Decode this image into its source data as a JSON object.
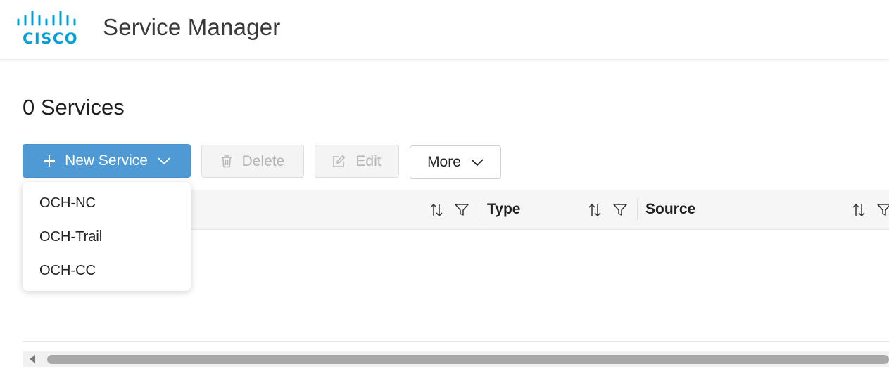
{
  "header": {
    "logo_text": "CISCO",
    "app_title": "Service Manager"
  },
  "page": {
    "count": "0",
    "title_word": "Services"
  },
  "toolbar": {
    "new_service_label": "New Service",
    "delete_label": "Delete",
    "edit_label": "Edit",
    "more_label": "More"
  },
  "dropdown": {
    "items": [
      "OCH-NC",
      "OCH-Trail",
      "OCH-CC"
    ]
  },
  "table": {
    "columns": [
      {
        "label": ""
      },
      {
        "label": "Type"
      },
      {
        "label": "Source"
      }
    ]
  },
  "colors": {
    "primary_button": "#4f9ad5",
    "cisco_blue": "#049fd9",
    "disabled_text": "#b5b5b5"
  },
  "icons": {
    "logo": "cisco-bars",
    "new_service": "plus-icon",
    "new_service_caret": "chevron-down-icon",
    "delete": "trash-icon",
    "edit": "edit-icon",
    "more_caret": "chevron-down-icon",
    "sort": "sort-icon",
    "filter": "filter-icon"
  }
}
